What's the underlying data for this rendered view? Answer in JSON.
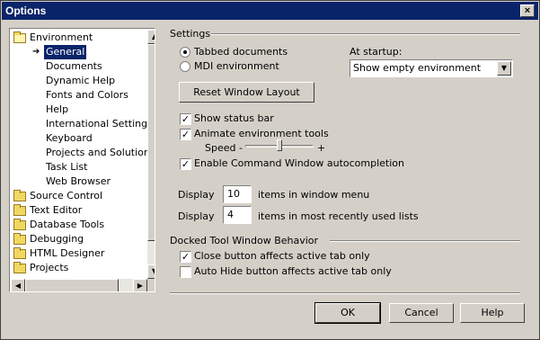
{
  "window": {
    "title": "Options",
    "close_glyph": "×"
  },
  "tree": {
    "items": [
      {
        "label": "Environment",
        "icon": "open-folder-icon",
        "expanded": true
      },
      {
        "label": "General",
        "selected": true
      },
      {
        "label": "Documents"
      },
      {
        "label": "Dynamic Help"
      },
      {
        "label": "Fonts and Colors"
      },
      {
        "label": "Help"
      },
      {
        "label": "International Settings"
      },
      {
        "label": "Keyboard"
      },
      {
        "label": "Projects and Solutions"
      },
      {
        "label": "Task List"
      },
      {
        "label": "Web Browser"
      },
      {
        "label": "Source Control",
        "icon": "folder-icon"
      },
      {
        "label": "Text Editor",
        "icon": "folder-icon"
      },
      {
        "label": "Database Tools",
        "icon": "folder-icon"
      },
      {
        "label": "Debugging",
        "icon": "folder-icon"
      },
      {
        "label": "HTML Designer",
        "icon": "folder-icon"
      },
      {
        "label": "Projects",
        "icon": "folder-icon"
      }
    ],
    "selected_marker": "➔"
  },
  "settings": {
    "group_label": "Settings",
    "radio_tabbed": {
      "label": "Tabbed documents",
      "checked": true
    },
    "radio_mdi": {
      "label": "MDI environment",
      "checked": false
    },
    "at_startup_label": "At startup:",
    "startup_value": "Show empty environment",
    "reset_button": "Reset Window Layout",
    "show_status_bar": {
      "label": "Show status bar",
      "checked": true
    },
    "animate_tools": {
      "label": "Animate environment tools",
      "checked": true
    },
    "speed_label": "Speed -",
    "speed_plus": "+",
    "speed_level": 0.5,
    "autocompletion": {
      "label": "Enable Command Window autocompletion",
      "checked": true
    },
    "display_label_1": "Display",
    "window_menu_count": "10",
    "window_menu_suffix": "items in window menu",
    "display_label_2": "Display",
    "mru_count": "4",
    "mru_suffix": "items in most recently used lists"
  },
  "docked": {
    "group_label": "Docked Tool Window Behavior",
    "close_button": {
      "label": "Close button affects active tab only",
      "checked": true
    },
    "auto_hide": {
      "label": "Auto Hide button affects active tab only",
      "checked": false
    }
  },
  "footer": {
    "ok": "OK",
    "cancel": "Cancel",
    "help": "Help"
  },
  "check_glyph": "✓"
}
